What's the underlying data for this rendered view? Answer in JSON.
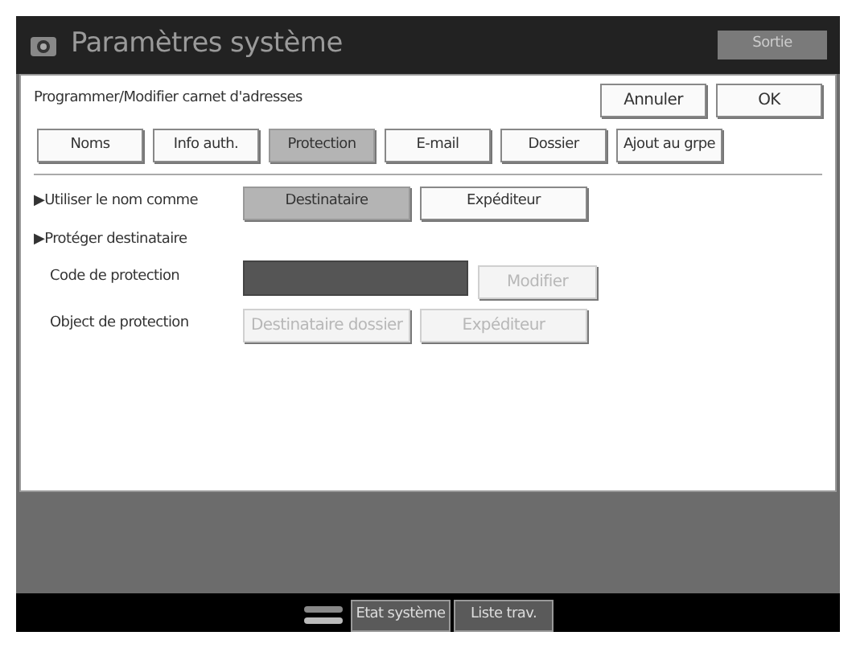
{
  "window": {
    "title": "Paramètres système",
    "exit_button": "Sortie"
  },
  "header": {
    "title": "Programmer/Modifier carnet d'adresses",
    "buttons": [
      "Annuler",
      "OK"
    ]
  },
  "tabs": [
    {
      "label": "Noms",
      "selected": false
    },
    {
      "label": "Info auth.",
      "selected": false
    },
    {
      "label": "Protection",
      "selected": true
    },
    {
      "label": "E-mail",
      "selected": false
    },
    {
      "label": "Dossier",
      "selected": false
    },
    {
      "label": "Ajout au grpe",
      "selected": false
    }
  ],
  "use_name_as": {
    "label": "▶Utiliser le nom comme",
    "options": [
      {
        "label": "Destinataire",
        "selected": true
      },
      {
        "label": "Expéditeur",
        "selected": false
      }
    ]
  },
  "protect": {
    "label": "▶Protéger destinataire",
    "code": {
      "label": "Code de protection",
      "button": {
        "label": "Modifier",
        "disabled": true
      }
    },
    "object": {
      "label": "Object de protection",
      "options": [
        {
          "label": "Destinataire dossier",
          "disabled": true
        },
        {
          "label": "Expéditeur",
          "disabled": true
        }
      ]
    }
  },
  "footer": {
    "buttons": [
      "Etat système",
      "Liste trav."
    ]
  }
}
